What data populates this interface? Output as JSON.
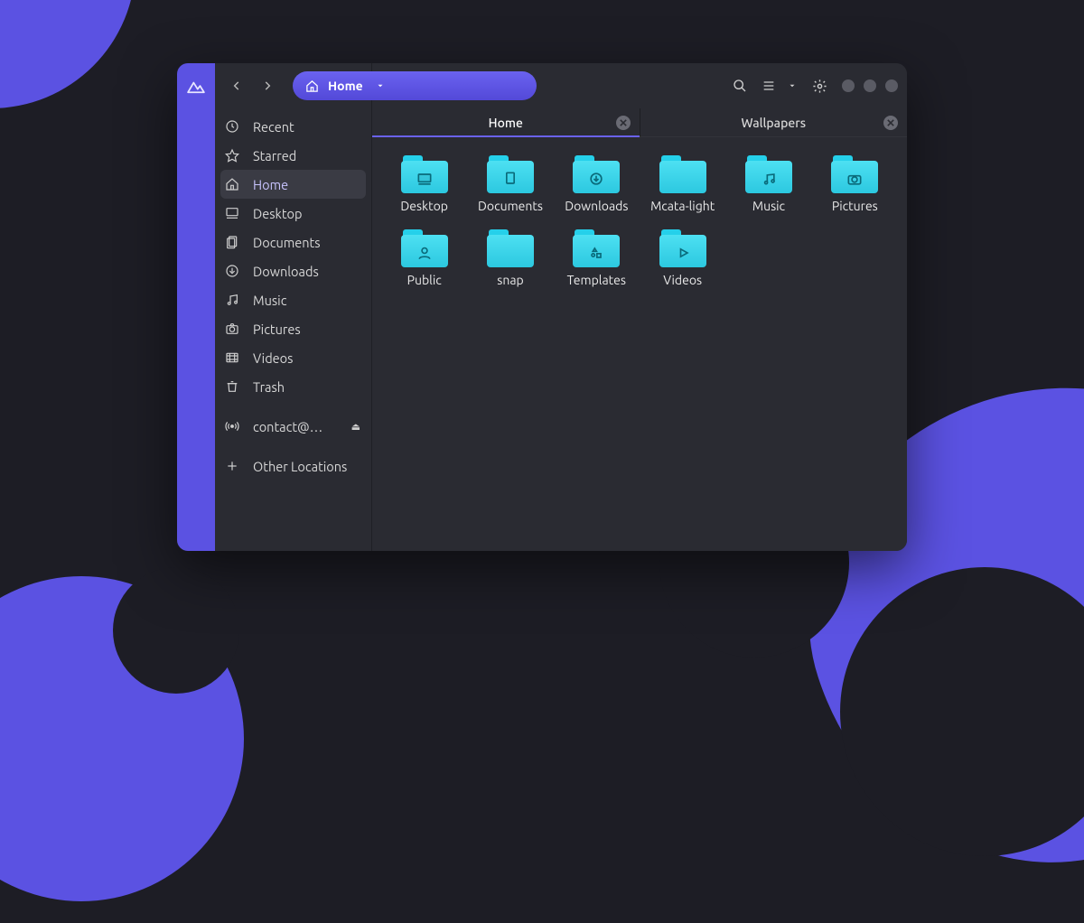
{
  "colors": {
    "accent": "#5b52e2",
    "folder": "#3ad6ec",
    "bg_dark": "#1d1d25",
    "surface": "#2a2b32"
  },
  "toolbar": {
    "path_label": "Home",
    "view_menu_icon": "list-icon",
    "settings_icon": "gear-icon"
  },
  "sidebar": {
    "items": [
      {
        "icon": "clock-icon",
        "label": "Recent"
      },
      {
        "icon": "star-icon",
        "label": "Starred"
      },
      {
        "icon": "home-icon",
        "label": "Home",
        "active": true
      },
      {
        "icon": "desktop-icon",
        "label": "Desktop"
      },
      {
        "icon": "documents-icon",
        "label": "Documents"
      },
      {
        "icon": "download-icon",
        "label": "Downloads"
      },
      {
        "icon": "music-icon",
        "label": "Music"
      },
      {
        "icon": "camera-icon",
        "label": "Pictures"
      },
      {
        "icon": "video-icon",
        "label": "Videos"
      },
      {
        "icon": "trash-icon",
        "label": "Trash"
      },
      {
        "icon": "broadcast-icon",
        "label": "contact@…",
        "eject": true
      },
      {
        "icon": "plus-icon",
        "label": "Other Locations"
      }
    ]
  },
  "tabs": [
    {
      "label": "Home",
      "active": true
    },
    {
      "label": "Wallpapers",
      "active": false
    }
  ],
  "folders": [
    {
      "name": "Desktop",
      "glyph": "desktop"
    },
    {
      "name": "Documents",
      "glyph": "document"
    },
    {
      "name": "Downloads",
      "glyph": "download"
    },
    {
      "name": "Mcata-light",
      "glyph": "plain"
    },
    {
      "name": "Music",
      "glyph": "music"
    },
    {
      "name": "Pictures",
      "glyph": "camera"
    },
    {
      "name": "Public",
      "glyph": "person"
    },
    {
      "name": "snap",
      "glyph": "plain"
    },
    {
      "name": "Templates",
      "glyph": "template"
    },
    {
      "name": "Videos",
      "glyph": "play"
    }
  ]
}
